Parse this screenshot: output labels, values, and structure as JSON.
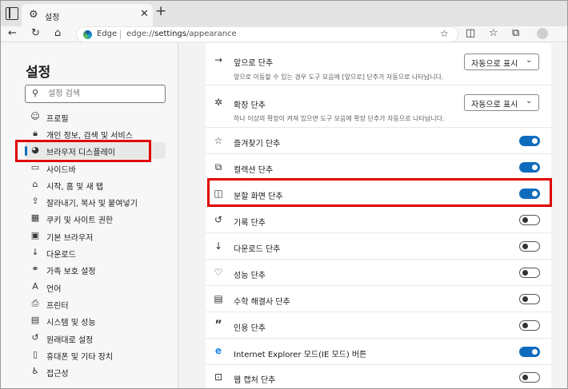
{
  "browser": {
    "tab_title": "설정",
    "tab_close": "✕",
    "new_tab": "+",
    "address_label": "Edge",
    "url_scheme": "edge://",
    "url_path": "settings",
    "url_rest": "/appearance",
    "icons": [
      "tab-actions-icon",
      "settings-gear-icon",
      "back-icon",
      "refresh-icon",
      "home-icon",
      "edge-logo-icon",
      "add-favorite-icon",
      "split-screen-icon",
      "favorites-icon",
      "collections-icon",
      "profile-icon"
    ]
  },
  "sidebar": {
    "title": "설정",
    "search_placeholder": "설정 검색",
    "items": [
      {
        "label": "프로필",
        "icon": "profile-icon"
      },
      {
        "label": "개인 정보, 검색 및 서비스",
        "icon": "lock-icon"
      },
      {
        "label": "브라우저 디스플레이",
        "icon": "appearance-icon",
        "active": true
      },
      {
        "label": "사이드바",
        "icon": "sidebar-icon"
      },
      {
        "label": "시작, 홈 및 새 탭",
        "icon": "home-icon"
      },
      {
        "label": "잘라내기, 복사 및 붙여넣기",
        "icon": "share-icon"
      },
      {
        "label": "쿠키 및 사이트 권한",
        "icon": "cookie-icon"
      },
      {
        "label": "기본 브라우저",
        "icon": "browser-icon"
      },
      {
        "label": "다운로드",
        "icon": "download-icon"
      },
      {
        "label": "가족 보호 설정",
        "icon": "family-icon"
      },
      {
        "label": "언어",
        "icon": "language-icon"
      },
      {
        "label": "프린터",
        "icon": "printer-icon"
      },
      {
        "label": "시스템 및 성능",
        "icon": "system-icon"
      },
      {
        "label": "원래대로 설정",
        "icon": "reset-icon"
      },
      {
        "label": "휴대폰 및 기타 장치",
        "icon": "phone-icon"
      },
      {
        "label": "접근성",
        "icon": "accessibility-icon"
      }
    ]
  },
  "settings": {
    "forward": {
      "label": "앞으로 단추",
      "desc": "앞으로 이동할 수 있는 경우 도구 모음에 [앞으로] 단추가 자동으로 나타납니다.",
      "value": "자동으로 표시"
    },
    "extensions": {
      "label": "확장 단추",
      "desc": "하나 이상의 확장이 켜져 있으면 도구 모음에 확장 단추가 자동으로 나타납니다.",
      "value": "자동으로 표시"
    },
    "toggles": [
      {
        "label": "즐겨찾기 단추",
        "icon": "favorites-icon",
        "on": true
      },
      {
        "label": "컬렉션 단추",
        "icon": "collections-icon",
        "on": true
      },
      {
        "label": "분할 화면 단추",
        "icon": "split-screen-icon",
        "on": true
      },
      {
        "label": "기록 단추",
        "icon": "history-icon",
        "on": false
      },
      {
        "label": "다운로드 단추",
        "icon": "download-icon",
        "on": false
      },
      {
        "label": "성능 단추",
        "icon": "performance-icon",
        "on": false
      },
      {
        "label": "수학 해결사 단추",
        "icon": "math-solver-icon",
        "on": false
      },
      {
        "label": "인용 단추",
        "icon": "citation-icon",
        "on": false
      },
      {
        "label": "Internet Explorer 모드(IE 모드) 버튼",
        "icon": "ie-mode-icon",
        "on": true
      },
      {
        "label": "웹 캡처 단추",
        "icon": "web-capture-icon",
        "on": false
      }
    ]
  },
  "colors": {
    "accent": "#0f6cbd",
    "highlight": "#e00000"
  }
}
